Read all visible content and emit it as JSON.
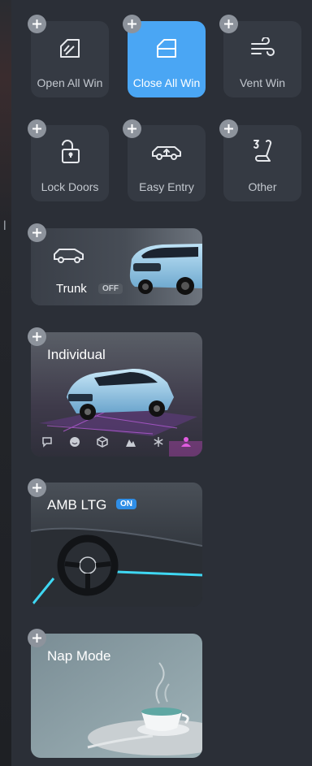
{
  "background": {
    "fragment": "l"
  },
  "quick_controls": [
    {
      "label": "Open All Win",
      "icon": "window-open-icon",
      "active": false
    },
    {
      "label": "Close All Win",
      "icon": "window-close-icon",
      "active": true
    },
    {
      "label": "Vent Win",
      "icon": "wind-icon",
      "active": false
    },
    {
      "label": "Lock Doors",
      "icon": "unlock-icon",
      "active": false
    },
    {
      "label": "Easy Entry",
      "icon": "car-lift-icon",
      "active": false
    },
    {
      "label": "Other",
      "icon": "seat-icon",
      "active": false
    }
  ],
  "cards": {
    "trunk": {
      "title": "Trunk",
      "state": "OFF"
    },
    "individual": {
      "title": "Individual"
    },
    "ambient": {
      "title": "AMB LTG",
      "state": "ON"
    },
    "nap": {
      "title": "Nap Mode"
    }
  },
  "colors": {
    "accent": "#4aa6f4",
    "panel": "#2b2f37",
    "tile": "#353a43",
    "on_badge": "#2f8ee6",
    "ambient_light": "#3fd7f2",
    "individual_highlight": "#d34bd0"
  }
}
